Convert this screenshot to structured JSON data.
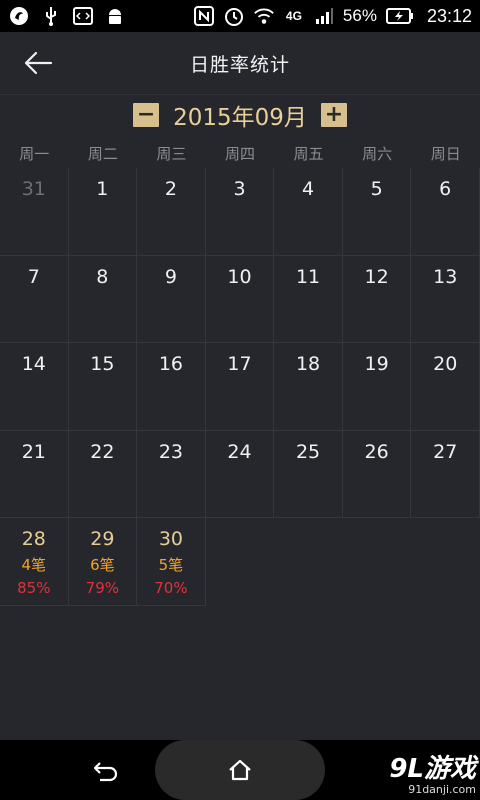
{
  "status_bar": {
    "network": "4G",
    "battery": "56%",
    "time": "23:12"
  },
  "header": {
    "title": "日胜率统计"
  },
  "month_selector": {
    "label": "2015年09月",
    "prev": "−",
    "next": "+"
  },
  "weekdays": [
    "周一",
    "周二",
    "周三",
    "周四",
    "周五",
    "周六",
    "周日"
  ],
  "calendar": {
    "weeks": [
      [
        {
          "d": "31",
          "other": true
        },
        {
          "d": "1"
        },
        {
          "d": "2"
        },
        {
          "d": "3"
        },
        {
          "d": "4"
        },
        {
          "d": "5"
        },
        {
          "d": "6"
        }
      ],
      [
        {
          "d": "7"
        },
        {
          "d": "8"
        },
        {
          "d": "9"
        },
        {
          "d": "10"
        },
        {
          "d": "11"
        },
        {
          "d": "12"
        },
        {
          "d": "13"
        }
      ],
      [
        {
          "d": "14"
        },
        {
          "d": "15"
        },
        {
          "d": "16"
        },
        {
          "d": "17"
        },
        {
          "d": "18"
        },
        {
          "d": "19"
        },
        {
          "d": "20"
        }
      ],
      [
        {
          "d": "21"
        },
        {
          "d": "22"
        },
        {
          "d": "23"
        },
        {
          "d": "24"
        },
        {
          "d": "25"
        },
        {
          "d": "26"
        },
        {
          "d": "27"
        }
      ],
      [
        {
          "d": "28",
          "count": "4笔",
          "rate": "85%"
        },
        {
          "d": "29",
          "count": "6笔",
          "rate": "79%"
        },
        {
          "d": "30",
          "count": "5笔",
          "rate": "70%"
        }
      ]
    ]
  },
  "watermark": {
    "brand": "9L游戏",
    "url": "91danji.com"
  },
  "colors": {
    "background": "#25272c",
    "accent_gold": "#e9cf98",
    "count_orange": "#f2a32d",
    "rate_red": "#e0323a"
  }
}
